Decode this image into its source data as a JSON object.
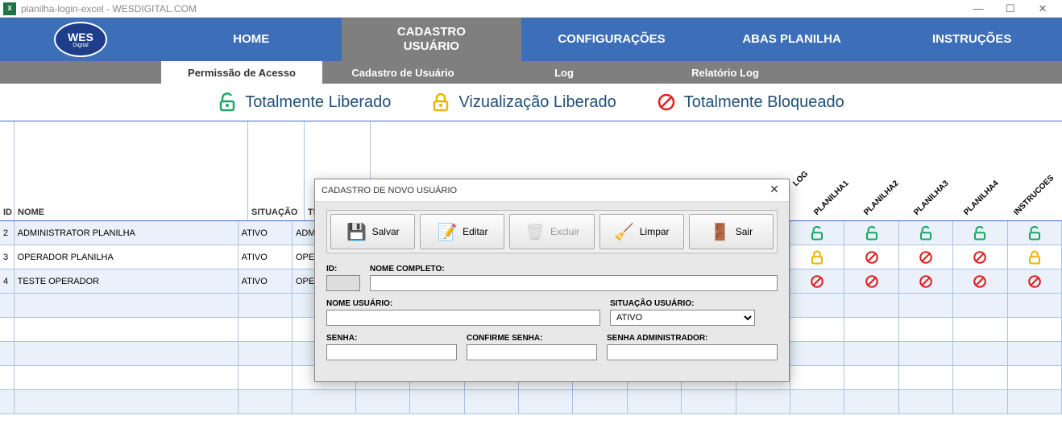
{
  "window": {
    "title": "planilha-login-excel - WESDIGITAL.COM",
    "excel_icon": "X"
  },
  "logo": {
    "line1": "WES",
    "line2": "Digital"
  },
  "nav": {
    "home": "HOME",
    "cadastro": "CADASTRO USUÁRIO",
    "config": "CONFIGURAÇÕES",
    "abas": "ABAS PLANILHA",
    "instrucoes": "INSTRUÇÕES"
  },
  "subnav": {
    "permissao": "Permissão de Acesso",
    "cadastro_usuario": "Cadastro de Usuário",
    "log": "Log",
    "relatorio": "Relatório Log"
  },
  "legend": {
    "liberado": "Totalmente Liberado",
    "visual": "Vizualização Liberado",
    "bloqueado": "Totalmente Bloqueado"
  },
  "headers": {
    "id": "ID",
    "nome": "NOME",
    "situacao": "SITUAÇÃO",
    "tipo": "TIPO U",
    "diag": [
      "LOG",
      "PLANILHA1",
      "PLANILHA2",
      "PLANILHA3",
      "PLANILHA4",
      "INSTRUCOES"
    ]
  },
  "rows": [
    {
      "id": "2",
      "nome": "ADMINISTRATOR PLANILHA",
      "sit": "ATIVO",
      "tipo": "ADMINI",
      "perms": [
        "green",
        "green",
        "green",
        "green",
        "green"
      ]
    },
    {
      "id": "3",
      "nome": "OPERADOR PLANILHA",
      "sit": "ATIVO",
      "tipo": "OPERA",
      "perms": [
        "yellow",
        "block",
        "block",
        "block",
        "yellow"
      ]
    },
    {
      "id": "4",
      "nome": "TESTE OPERADOR",
      "sit": "ATIVO",
      "tipo": "OPERA",
      "perms": [
        "block",
        "block",
        "block",
        "block",
        "block"
      ]
    }
  ],
  "dialog": {
    "title": "CADASTRO DE NOVO USUÁRIO",
    "buttons": {
      "salvar": "Salvar",
      "editar": "Editar",
      "excluir": "Excluir",
      "limpar": "Limpar",
      "sair": "Sair"
    },
    "labels": {
      "id": "ID:",
      "nome_completo": "NOME COMPLETO:",
      "nome_usuario": "NOME USUÁRIO:",
      "situacao_usuario": "SITUAÇÃO USUÁRIO:",
      "senha": "SENHA:",
      "confirme_senha": "CONFIRME SENHA:",
      "senha_admin": "SENHA ADMINISTRADOR:"
    },
    "situacao_value": "ATIVO"
  }
}
